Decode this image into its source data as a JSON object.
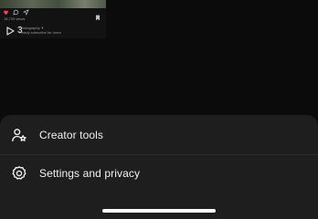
{
  "post_thumbnail": {
    "icons": [
      "heart-icon",
      "comment-icon",
      "share-icon",
      "bookmark-icon",
      "play-icon"
    ],
    "caption_line_1": "18,733 views",
    "caption_line_2": "Photography ✦",
    "caption_line_3": "Ready subscribe for more",
    "play_count": "3"
  },
  "menu_sheet": {
    "items": [
      {
        "icon": "creator-tools-icon",
        "label": "Creator tools"
      },
      {
        "icon": "settings-gear-icon",
        "label": "Settings and privacy"
      }
    ]
  },
  "colors": {
    "background": "#0b0b0b",
    "sheet": "#1e1e1f",
    "text": "#f2f2f2",
    "like_red": "#ff3b5c"
  }
}
